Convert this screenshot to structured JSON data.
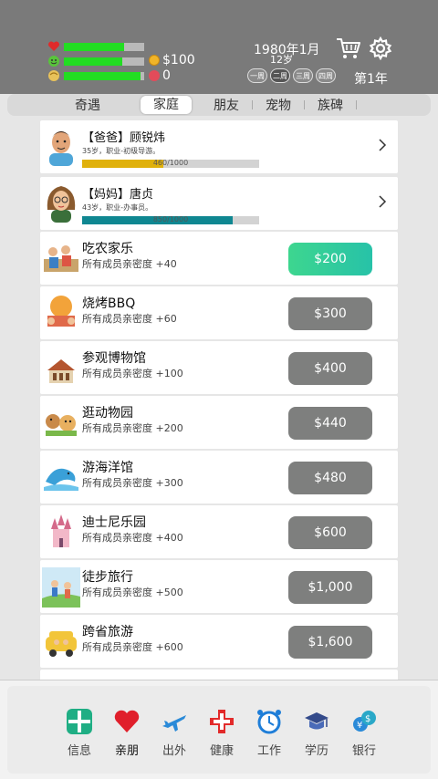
{
  "header": {
    "stats": {
      "health_pct": 0.75,
      "mood_pct": 0.73,
      "smart_pct": 0.95
    },
    "money": "$100",
    "hearts": "0",
    "date": "1980年1月",
    "age": "12岁",
    "seasons": [
      "一周",
      "二周",
      "三周",
      "四周"
    ],
    "year": "第1年",
    "icons": {
      "cart": "cart-icon",
      "settings": "gear-icon"
    }
  },
  "tabs": [
    {
      "label": "奇遇"
    },
    {
      "label": "家庭",
      "active": true
    },
    {
      "label": "朋友"
    },
    {
      "label": "宠物"
    },
    {
      "label": "族碑"
    }
  ],
  "family": [
    {
      "name": "【爸爸】顾锐炜",
      "desc": "35岁，职业-初级导游。",
      "progress_text": "460/1000",
      "progress": 0.46,
      "bar_color": "#e0b10c"
    },
    {
      "name": "【妈妈】唐贞",
      "desc": "43岁，职业-办事员。",
      "progress_text": "850/1000",
      "progress": 0.85,
      "bar_color": "#0f8791"
    }
  ],
  "activities": [
    {
      "name": "吃农家乐",
      "desc": "所有成员亲密度 +40",
      "price": "$200",
      "active": true
    },
    {
      "name": "烧烤BBQ",
      "desc": "所有成员亲密度 +60",
      "price": "$300"
    },
    {
      "name": "参观博物馆",
      "desc": "所有成员亲密度 +100",
      "price": "$400"
    },
    {
      "name": "逛动物园",
      "desc": "所有成员亲密度 +200",
      "price": "$440"
    },
    {
      "name": "游海洋馆",
      "desc": "所有成员亲密度 +300",
      "price": "$480"
    },
    {
      "name": "迪士尼乐园",
      "desc": "所有成员亲密度 +400",
      "price": "$600"
    },
    {
      "name": "徒步旅行",
      "desc": "所有成员亲密度 +500",
      "price": "$1,000"
    },
    {
      "name": "跨省旅游",
      "desc": "所有成员亲密度 +600",
      "price": "$1,600"
    }
  ],
  "nav": [
    {
      "label": "信息",
      "icon": "info-grid-icon"
    },
    {
      "label": "亲朋",
      "icon": "heart-icon",
      "active": true
    },
    {
      "label": "出外",
      "icon": "airplane-icon"
    },
    {
      "label": "健康",
      "icon": "medical-cross-icon"
    },
    {
      "label": "工作",
      "icon": "alarm-clock-icon"
    },
    {
      "label": "学历",
      "icon": "graduation-cap-icon"
    },
    {
      "label": "银行",
      "icon": "currency-exchange-icon"
    }
  ],
  "colors": {
    "header_bg": "#7a7a7a",
    "stat_bar": "#22dd22",
    "active_button": "#2fcf9c",
    "inactive_button": "#7e7f7e"
  }
}
